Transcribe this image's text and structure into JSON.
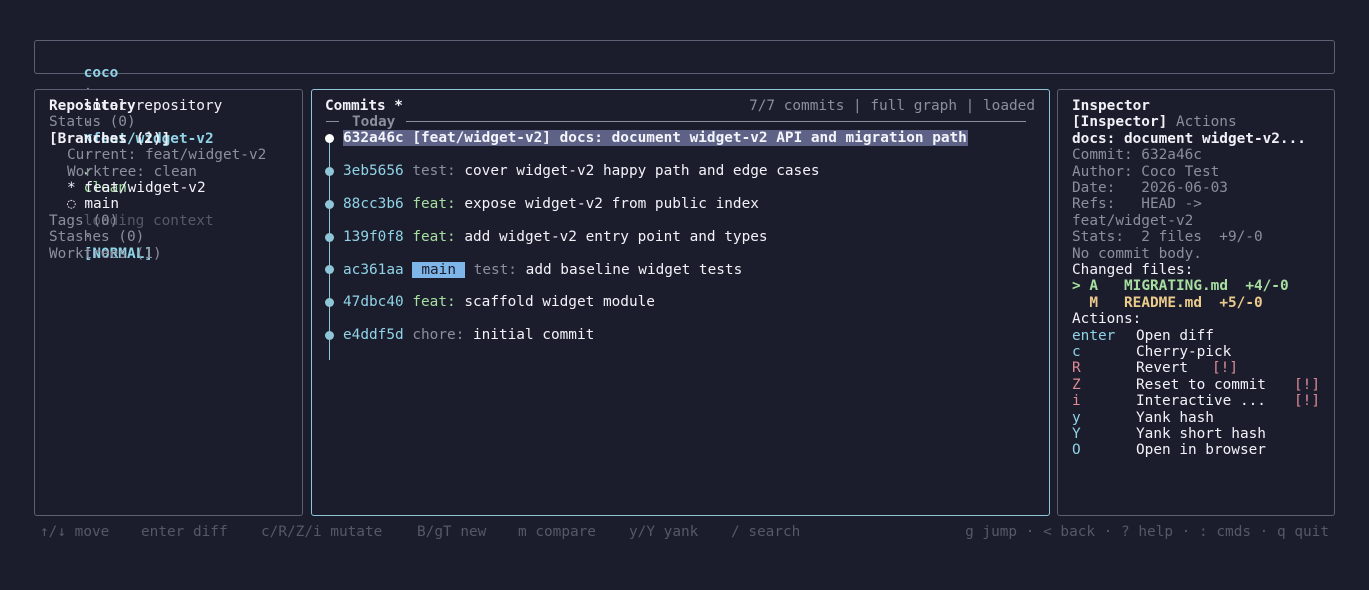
{
  "top": {
    "app": "coco",
    "sep": "·",
    "location": "local repository",
    "branch_icon": "⌥",
    "branch": "feat/widget-v2",
    "clean_mark": "✓",
    "clean": "clean",
    "loading": "loading context",
    "mode": "[NORMAL]"
  },
  "repo": {
    "title": "Repository",
    "status": "Status (0)",
    "branches": "[Branches (2)]",
    "current": "Current: feat/widget-v2",
    "worktree": "Worktree: clean",
    "branch_items": [
      {
        "marker": "*",
        "name": "feat/widget-v2"
      },
      {
        "marker": "◌",
        "name": "main"
      }
    ],
    "tags": "Tags (0)",
    "stashes": "Stashes (0)",
    "worktrees": "Worktrees (1)"
  },
  "commits": {
    "title": "Commits *",
    "summary": "7/7 commits | full graph | loaded",
    "day_label": "Today",
    "items": [
      {
        "hash": "632a46c",
        "refs": "[feat/widget-v2]",
        "type": "docs:",
        "msg": "document widget-v2 API and migration path"
      },
      {
        "hash": "3eb5656",
        "type": "test:",
        "msg": "cover widget-v2 happy path and edge cases"
      },
      {
        "hash": "88cc3b6",
        "type": "feat:",
        "msg": "expose widget-v2 from public index"
      },
      {
        "hash": "139f0f8",
        "type": "feat:",
        "msg": "add widget-v2 entry point and types"
      },
      {
        "hash": "ac361aa",
        "chip": "main",
        "type": "test:",
        "msg": "add baseline widget tests"
      },
      {
        "hash": "47dbc40",
        "type": "feat:",
        "msg": "scaffold widget module"
      },
      {
        "hash": "e4ddf5d",
        "type": "chore:",
        "msg": "initial commit"
      }
    ]
  },
  "inspector": {
    "title": "Inspector",
    "tab_active": "[Inspector]",
    "tab_other": "Actions",
    "subject": "docs: document widget-v2...",
    "commit": "Commit: 632a46c",
    "author": "Author: Coco Test",
    "date": "Date:   2026-06-03",
    "refs": "Refs:   HEAD ->",
    "refs_cont": "feat/widget-v2",
    "stats": "Stats:  2 files  +9/-0",
    "body": "No commit body.",
    "changed_title": "Changed files:",
    "files": [
      {
        "sel": ">",
        "status": "A",
        "name": "MIGRATING.md",
        "delta": "+4/-0"
      },
      {
        "sel": " ",
        "status": "M",
        "name": "README.md",
        "delta": "+5/-0"
      }
    ],
    "actions_title": "Actions:",
    "actions": [
      {
        "key": "enter",
        "label": "Open diff",
        "warn": ""
      },
      {
        "key": "c",
        "label": "Cherry-pick",
        "warn": ""
      },
      {
        "key": "R",
        "label": "Revert",
        "warn": "[!]"
      },
      {
        "key": "Z",
        "label": "Reset to commit",
        "warn": "[!]"
      },
      {
        "key": "i",
        "label": "Interactive ...",
        "warn": "[!]"
      },
      {
        "key": "y",
        "label": "Yank hash",
        "warn": ""
      },
      {
        "key": "Y",
        "label": "Yank short hash",
        "warn": ""
      },
      {
        "key": "O",
        "label": "Open in browser",
        "warn": ""
      }
    ]
  },
  "footer": {
    "left": [
      "↑/↓ move",
      "enter diff",
      "c/R/Z/i mutate",
      "B/gT new",
      "m compare",
      "y/Y yank",
      "/ search"
    ],
    "right": "g jump · < back · ? help · : cmds · q quit"
  },
  "colors": {
    "background": "#1c1d2c",
    "accent": "#8ec6d8",
    "selection": "#5e6286",
    "chip": "#7eb6ea",
    "warn": "#e08a96"
  }
}
